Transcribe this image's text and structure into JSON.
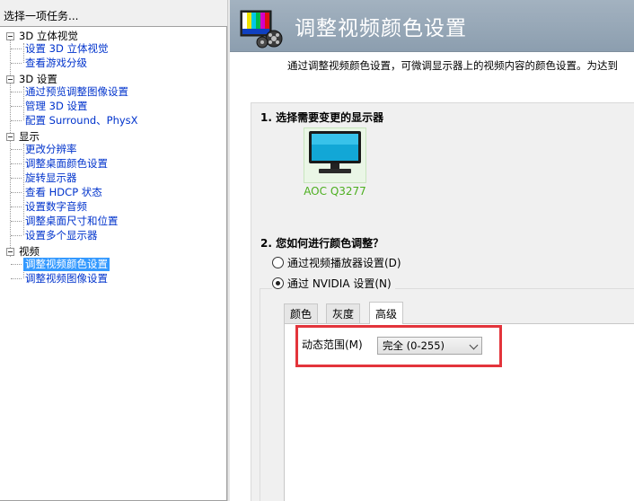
{
  "task_header": "选择一项任务...",
  "tree": [
    {
      "label": "3D 立体视觉",
      "items": [
        "设置 3D 立体视觉",
        "查看游戏分级"
      ]
    },
    {
      "label": "3D 设置",
      "items": [
        "通过预览调整图像设置",
        "管理 3D 设置",
        "配置 Surround、PhysX"
      ]
    },
    {
      "label": "显示",
      "items": [
        "更改分辨率",
        "调整桌面颜色设置",
        "旋转显示器",
        "查看 HDCP 状态",
        "设置数字音频",
        "调整桌面尺寸和位置",
        "设置多个显示器"
      ]
    },
    {
      "label": "视频",
      "items": [
        "调整视频颜色设置",
        "调整视频图像设置"
      ]
    }
  ],
  "selected_item": "调整视频颜色设置",
  "page": {
    "title": "调整视频颜色设置",
    "description": "通过调整视频颜色设置，可微调显示器上的视频内容的颜色设置。为达到",
    "section1_title": "1. 选择需要变更的显示器",
    "monitor_name": "AOC Q3277",
    "section2_title": "2. 您如何进行颜色调整？",
    "radio_player": "通过视频播放器设置(D)",
    "radio_nvidia": "通过 NVIDIA 设置(N)",
    "tabs": [
      "颜色",
      "灰度",
      "高级"
    ],
    "active_tab": "高级",
    "dynamic_range_label": "动态范围(M)",
    "dynamic_range_value": "完全 (0-255)"
  },
  "colors": {
    "link": "#0033cc",
    "selection": "#3399ff",
    "highlight": "#e3343b",
    "monitor_label": "#4caf1f"
  }
}
